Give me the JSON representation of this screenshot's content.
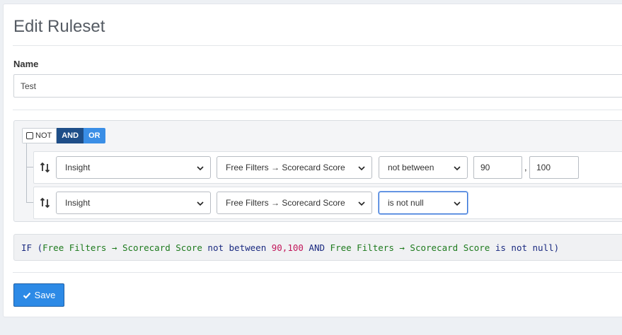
{
  "page": {
    "title": "Edit Ruleset"
  },
  "name_field": {
    "label": "Name",
    "value": "Test"
  },
  "builder": {
    "toggles": {
      "not": "NOT",
      "and": "AND",
      "or": "OR",
      "active": "AND"
    },
    "rules": [
      {
        "source": "Insight",
        "field": "Free Filters → Scorecard Score",
        "operator": "not between",
        "value1": "90",
        "separator": ",",
        "value2": "100"
      },
      {
        "source": "Insight",
        "field": "Free Filters → Scorecard Score",
        "operator": "is not null"
      }
    ]
  },
  "sql_preview": {
    "kw_if": "IF",
    "paren_open": " (",
    "field1": "Free Filters → Scorecard Score",
    "op1": " not between ",
    "num1": "90,100",
    "kw_and": " AND ",
    "field2": "Free Filters → Scorecard Score",
    "op2": " is not null",
    "paren_close": ")"
  },
  "actions": {
    "save_label": "Save",
    "save_icon": "check-icon"
  },
  "colors": {
    "accent": "#2d8ae6",
    "and_active": "#1e4e88",
    "or": "#3a8ee6"
  }
}
